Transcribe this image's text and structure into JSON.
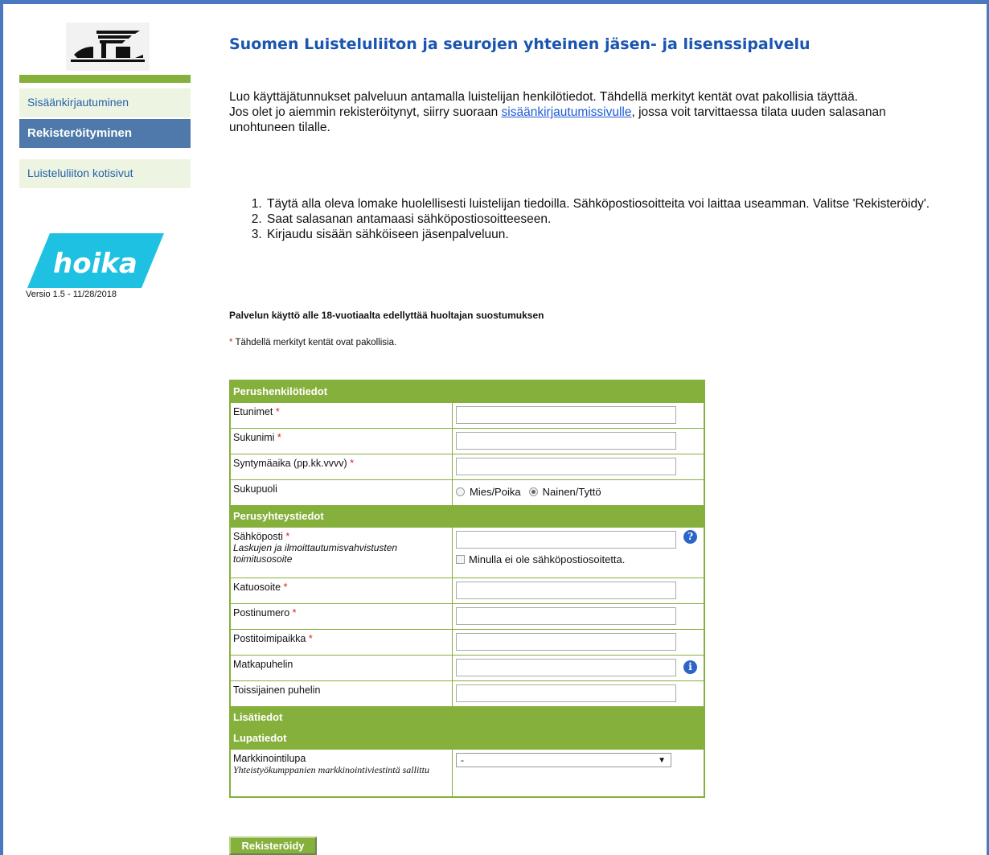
{
  "sidebar": {
    "nav": {
      "login": "Sisäänkirjautuminen",
      "register": "Rekisteröityminen",
      "home": "Luisteluliiton kotisivut"
    },
    "brand": "hoika",
    "version": "Versio 1.5 - 11/28/2018"
  },
  "main": {
    "title": "Suomen Luisteluliiton ja seurojen yhteinen jäsen- ja lisenssipalvelu",
    "intro_line1": "Luo käyttäjätunnukset palveluun antamalla luistelijan henkilötiedot. Tähdellä merkityt kentät ovat pakollisia täyttää.",
    "intro_line2_before": "Jos olet jo aiemmin rekisteröitynyt, siirry suoraan ",
    "intro_link": "sisäänkirjautumissivulle",
    "intro_line2_after": ", jossa voit tarvittaessa tilata uuden salasanan unohtuneen tilalle.",
    "steps": [
      "Täytä alla oleva lomake huolellisesti luistelijan tiedoilla. Sähköpostiosoitteita voi laittaa useamman. Valitse 'Rekisteröidy'.",
      "Saat salasanan antamaasi sähköpostiosoitteeseen.",
      "Kirjaudu sisään sähköiseen jäsenpalveluun."
    ],
    "guardian_notice": "Palvelun käyttö alle 18-vuotiaalta edellyttää huoltajan suostumuksen",
    "required_star": "*",
    "required_note": " Tähdellä merkityt kentät ovat pakollisia."
  },
  "form": {
    "section_personal": "Perushenkilötiedot",
    "first_name": "Etunimet",
    "last_name": "Sukunimi",
    "birth_date": "Syntymäaika (pp.kk.vvvv)",
    "gender": "Sukupuoli",
    "gender_options": {
      "male": "Mies/Poika",
      "female": "Nainen/Tyttö"
    },
    "section_contact": "Perusyhteystiedot",
    "email": "Sähköposti",
    "email_sub": "Laskujen ja ilmoittautumisvahvistusten toimitusosoite",
    "no_email": "Minulla ei ole sähköpostiosoitetta.",
    "street": "Katuosoite",
    "postal_code": "Postinumero",
    "city": "Postitoimipaikka",
    "mobile": "Matkapuhelin",
    "secondary_phone": "Toissijainen puhelin",
    "section_extra": "Lisätiedot",
    "section_permissions": "Lupatiedot",
    "marketing": "Markkinointilupa",
    "marketing_sub": "Yhteistyökumppanien markkinointiviestintä sallittu",
    "marketing_value": "-",
    "submit": "Rekisteröidy",
    "star": "*"
  },
  "colors": {
    "accent_green": "#86b03c",
    "nav_active": "#4e79aa",
    "title_blue": "#1a55b0",
    "required_red": "#e0201c"
  },
  "icons": [
    "skate-logo",
    "help-icon",
    "info-icon",
    "dropdown-arrow-icon"
  ]
}
